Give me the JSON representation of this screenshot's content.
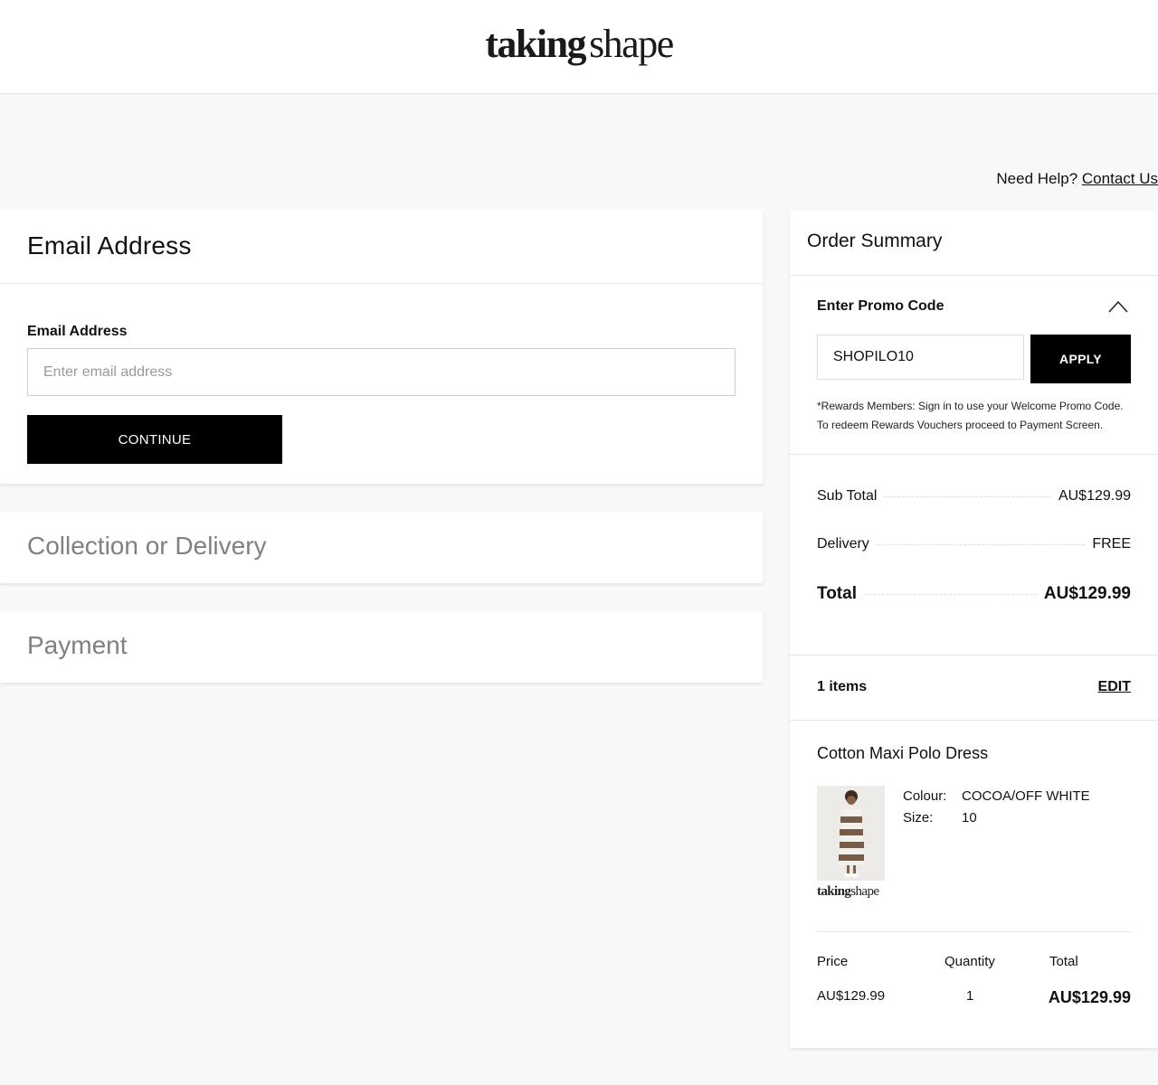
{
  "brand": {
    "logo_part1": "taking",
    "logo_part2": "shape"
  },
  "help": {
    "text": "Need Help?",
    "link": "Contact Us"
  },
  "email_section": {
    "title": "Email Address",
    "label": "Email Address",
    "placeholder": "Enter email address",
    "continue_label": "CONTINUE"
  },
  "steps": {
    "collection": "Collection or Delivery",
    "payment": "Payment"
  },
  "summary": {
    "title": "Order Summary",
    "promo_label": "Enter Promo Code",
    "promo_value": "SHOPILO10",
    "apply_label": "APPLY",
    "promo_note_1": "*Rewards Members: Sign in to use your Welcome Promo Code.",
    "promo_note_2": "To redeem Rewards Vouchers proceed to Payment Screen.",
    "subtotal_label": "Sub Total",
    "subtotal_value": "AU$129.99",
    "delivery_label": "Delivery",
    "delivery_value": "FREE",
    "total_label": "Total",
    "total_value": "AU$129.99",
    "items_count": "1 items",
    "edit_label": "EDIT"
  },
  "item": {
    "name": "Cotton Maxi Polo Dress",
    "colour_label": "Colour:",
    "colour_value": "COCOA/OFF WHITE",
    "size_label": "Size:",
    "size_value": "10",
    "price_header": "Price",
    "quantity_header": "Quantity",
    "total_header": "Total",
    "price": "AU$129.99",
    "quantity": "1",
    "total": "AU$129.99",
    "stripe_colors": [
      "#7a5a48",
      "#f4f0ea"
    ]
  }
}
